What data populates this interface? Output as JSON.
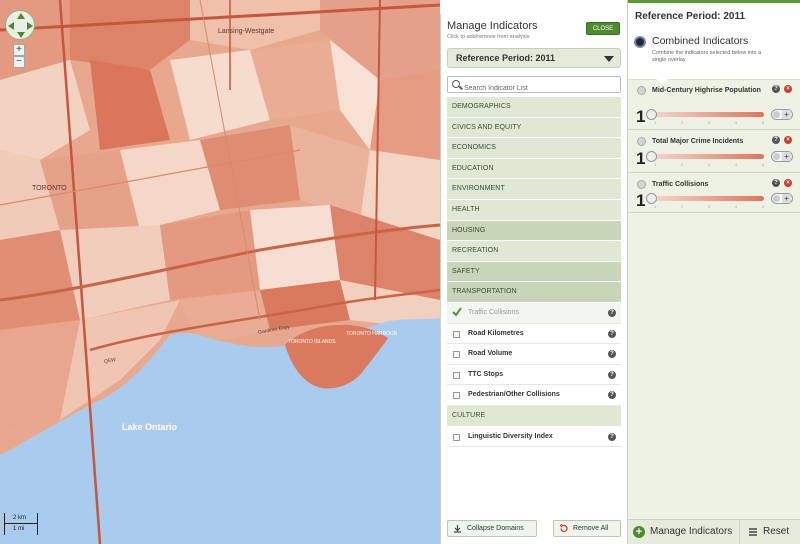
{
  "map": {
    "labels": {
      "lansing": "Lansing-Westgate",
      "toronto": "TORONTO",
      "lake": "Lake Ontario",
      "islands": "TORONTO ISLANDS",
      "harbour": "TORONTO HARBOUR",
      "gardiner": "Gardiner Expy",
      "qew": "QEW"
    },
    "scale": {
      "km": "2 km",
      "mi": "1 mi"
    },
    "colors": {
      "water": "#a9cbed",
      "choropleth_dark": "#d9735a",
      "choropleth_light": "#f7e4d8"
    }
  },
  "manage": {
    "title": "Manage Indicators",
    "subtitle": "Click to add/remove from analysis",
    "close_label": "CLOSE",
    "reference_period": "Reference Period: 2011",
    "search_placeholder": "Search Indicator List",
    "domains": [
      {
        "label": "DEMOGRAPHICS",
        "shade": "light"
      },
      {
        "label": "CIVICS AND EQUITY",
        "shade": "light"
      },
      {
        "label": "ECONOMICS",
        "shade": "light"
      },
      {
        "label": "EDUCATION",
        "shade": "light"
      },
      {
        "label": "ENVIRONMENT",
        "shade": "light"
      },
      {
        "label": "HEALTH",
        "shade": "light"
      },
      {
        "label": "HOUSING",
        "shade": "dark"
      },
      {
        "label": "RECREATION",
        "shade": "light"
      },
      {
        "label": "SAFETY",
        "shade": "dark"
      },
      {
        "label": "TRANSPORTATION",
        "shade": "dark"
      }
    ],
    "transportation_items": [
      {
        "label": "Traffic Collisions",
        "checked": true
      },
      {
        "label": "Road Kilometres",
        "checked": false
      },
      {
        "label": "Road Volume",
        "checked": false
      },
      {
        "label": "TTC Stops",
        "checked": false
      },
      {
        "label": "Pedestrian/Other Collisions",
        "checked": false
      }
    ],
    "culture_domain": "CULTURE",
    "culture_items": [
      {
        "label": "Linguistic Diversity Index",
        "checked": false
      }
    ],
    "help_glyph": "?",
    "collapse_label": "Collapse Domains",
    "remove_all_label": "Remove All"
  },
  "right": {
    "reference_period": "Reference Period: 2011",
    "combined_title": "Combined Indicators",
    "combined_desc": "Combine the indicators selected below into a single overlay",
    "selected": [
      {
        "name": "Mid-Century Highrise Population",
        "weight": "1"
      },
      {
        "name": "Total Major Crime Incidents",
        "weight": "1"
      },
      {
        "name": "Traffic Collisions",
        "weight": "1"
      }
    ],
    "help_glyph": "?",
    "remove_glyph": "×",
    "toggle_glyph": "+",
    "tick_marks": [
      "1",
      "2",
      "3",
      "4",
      "5"
    ],
    "manage_label": "Manage Indicators",
    "manage_glyph": "+",
    "reset_label": "Reset",
    "accent_color": "#4e8b2e"
  }
}
